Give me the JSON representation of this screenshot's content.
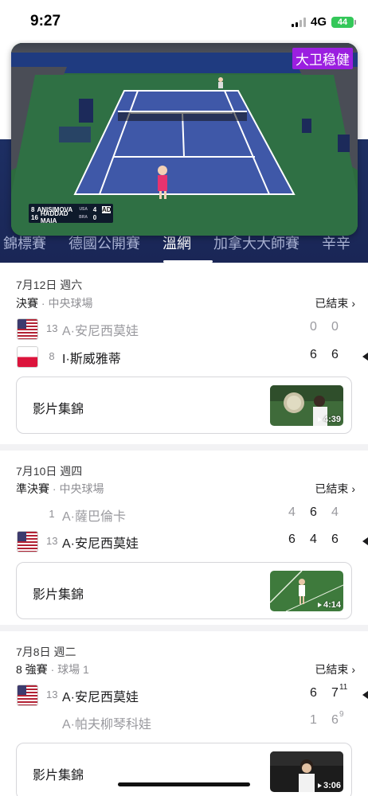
{
  "status_bar": {
    "time": "9:27",
    "network": "4G",
    "battery": "44"
  },
  "video": {
    "watermark": "大卫稳健",
    "scoreboard": {
      "rows": [
        {
          "seed": "8",
          "name": "ANISIMOVA",
          "country": "USA",
          "games": "4",
          "points": "AD"
        },
        {
          "seed": "16",
          "name": "HADDAD MAIA",
          "country": "BRA",
          "games": "0",
          "points": ""
        }
      ]
    }
  },
  "tabs": [
    {
      "label": "錦標賽",
      "active": false
    },
    {
      "label": "德國公開賽",
      "active": false
    },
    {
      "label": "溫網",
      "active": true
    },
    {
      "label": "加拿大大師賽",
      "active": false
    },
    {
      "label": "辛辛",
      "active": false
    }
  ],
  "matches": [
    {
      "date": "7月12日 週六",
      "round": "決賽",
      "court": "中央球場",
      "status": "已結束",
      "players": [
        {
          "flag": "usa",
          "seed": "13",
          "name": "A·安尼西莫娃",
          "winner": false,
          "scores": [
            "0",
            "0"
          ]
        },
        {
          "flag": "pol",
          "seed": "8",
          "name": "I·斯威雅蒂",
          "winner": true,
          "scores": [
            "6",
            "6"
          ]
        }
      ],
      "highlight": {
        "label": "影片集錦",
        "duration": "4:39"
      }
    },
    {
      "date": "7月10日 週四",
      "round": "準決賽",
      "court": "中央球場",
      "status": "已結束",
      "players": [
        {
          "flag": "none",
          "seed": "1",
          "name": "A·薩巴倫卡",
          "winner": false,
          "scores": [
            "4",
            "6",
            "4"
          ]
        },
        {
          "flag": "usa",
          "seed": "13",
          "name": "A·安尼西莫娃",
          "winner": true,
          "scores": [
            "6",
            "4",
            "6"
          ]
        }
      ],
      "highlight": {
        "label": "影片集錦",
        "duration": "4:14"
      }
    },
    {
      "date": "7月8日 週二",
      "round": "8 強賽",
      "court": "球場 1",
      "status": "已結束",
      "players": [
        {
          "flag": "usa",
          "seed": "13",
          "name": "A·安尼西莫娃",
          "winner": true,
          "scores": [
            "6",
            "7"
          ],
          "tiebreaks": [
            "",
            "11"
          ]
        },
        {
          "flag": "none",
          "seed": "",
          "name": "A·帕夫柳琴科娃",
          "winner": false,
          "scores": [
            "1",
            "6"
          ],
          "tiebreaks": [
            "",
            "9"
          ]
        }
      ],
      "highlight": {
        "label": "影片集錦",
        "duration": "3:06"
      }
    }
  ],
  "colors": {
    "band": "#1d2f63",
    "court_blue": "#3f58a8",
    "court_green": "#2b6a3c",
    "flag_usa_red": "#b22234",
    "flag_usa_blue": "#3c3b6e",
    "flag_pol_red": "#dc143c"
  }
}
